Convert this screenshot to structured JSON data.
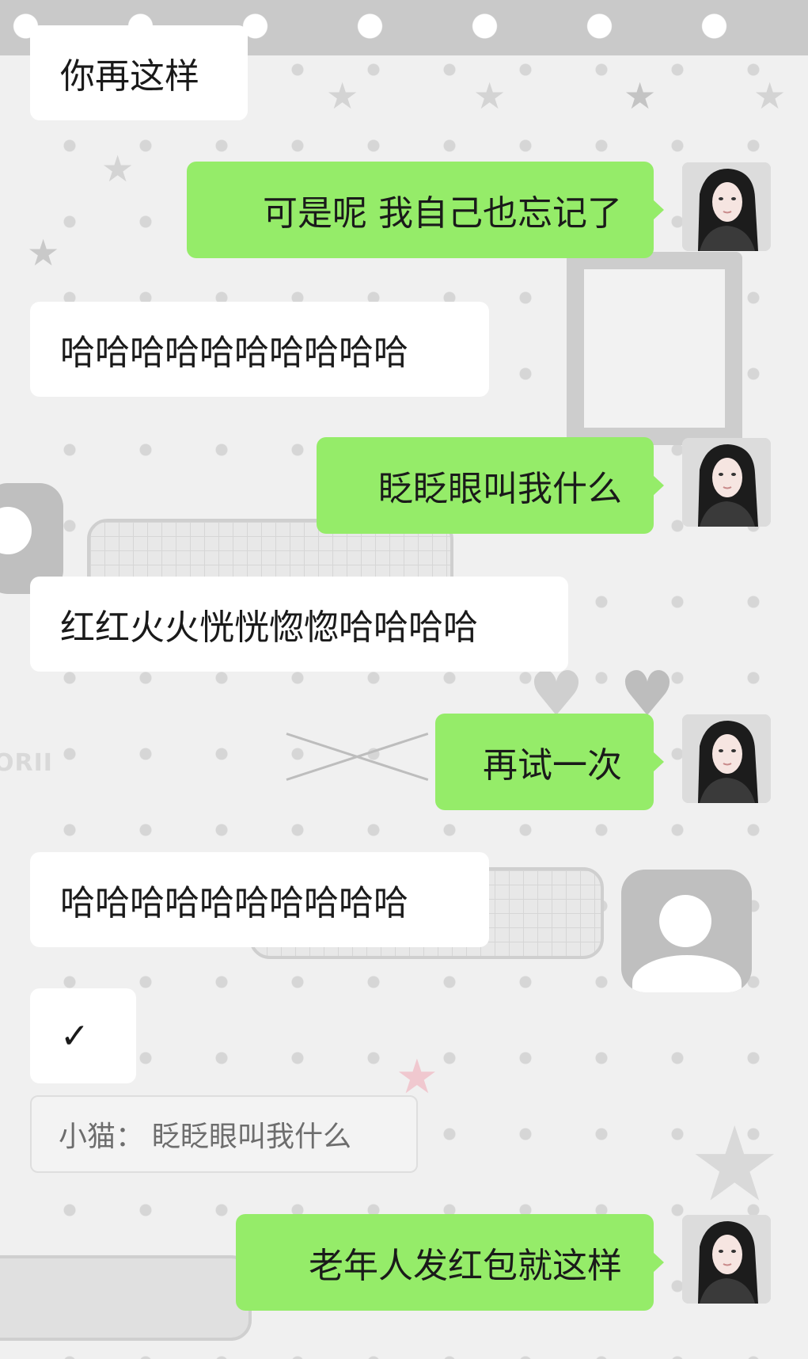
{
  "chat": {
    "messages": [
      {
        "direction": "in",
        "text": "你再这样"
      },
      {
        "direction": "out",
        "text": "可是呢 我自己也忘记了"
      },
      {
        "direction": "in",
        "text": "哈哈哈哈哈哈哈哈哈哈"
      },
      {
        "direction": "out",
        "text": "眨眨眼叫我什么"
      },
      {
        "direction": "in",
        "text": "红红火火恍恍惚惚哈哈哈哈"
      },
      {
        "direction": "out",
        "text": "再试一次"
      },
      {
        "direction": "in",
        "text": "哈哈哈哈哈哈哈哈哈哈"
      },
      {
        "direction": "in",
        "text": "✓"
      },
      {
        "direction": "out",
        "text": "老年人发红包就这样"
      }
    ],
    "quote": {
      "sender": "小猫",
      "separator": "：",
      "text": "眨眨眼叫我什么"
    }
  },
  "decor": {
    "watermark": "ORII"
  },
  "colors": {
    "incoming_bubble": "#ffffff",
    "outgoing_bubble": "#95ec69",
    "background": "#f0f0f0",
    "quote_text": "#6d6d6d"
  }
}
